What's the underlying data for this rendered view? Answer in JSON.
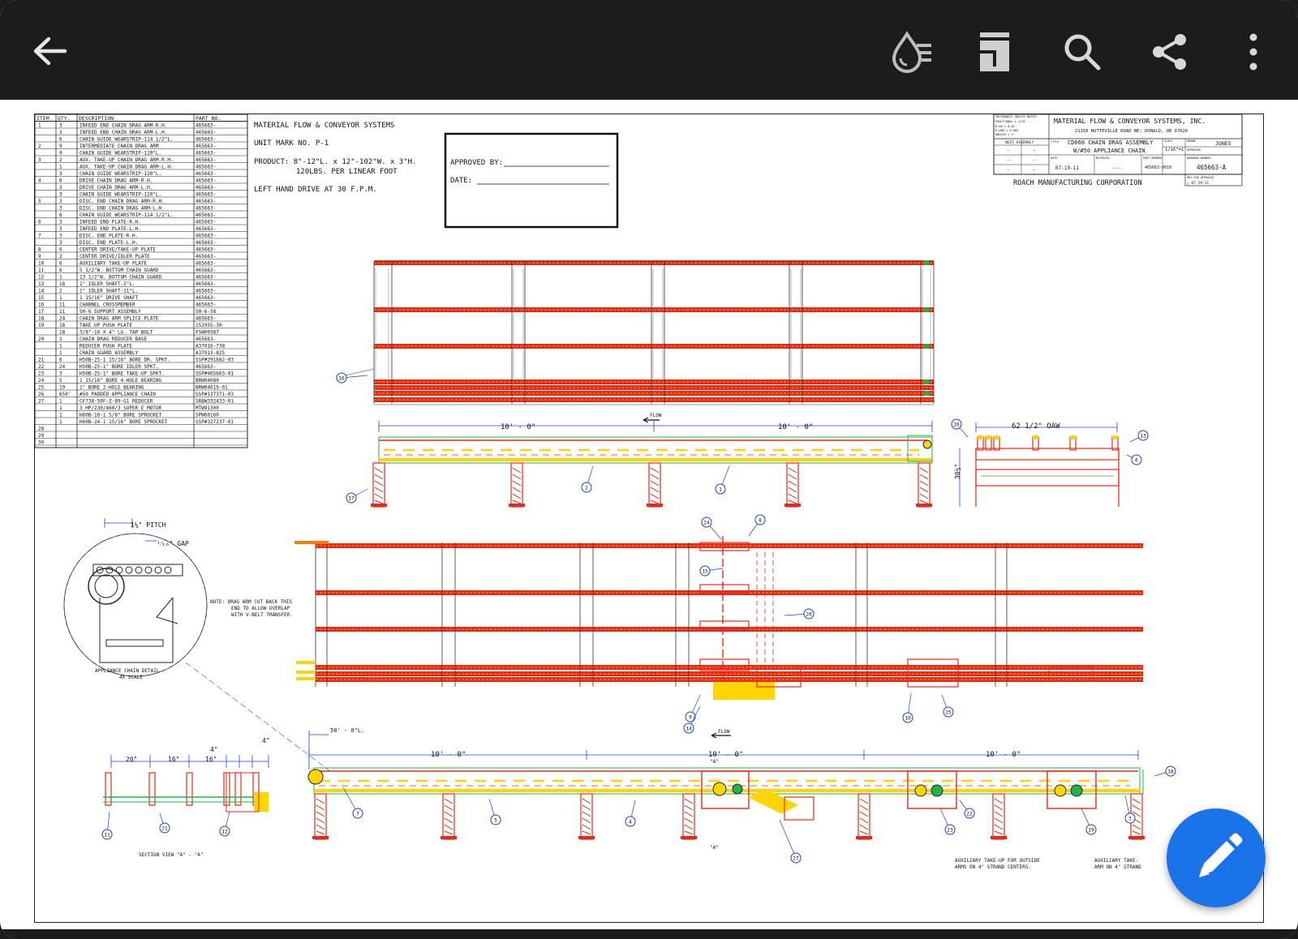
{
  "colors": {
    "appbar": "#1c1c1c",
    "fab": "#1a73e8",
    "conveyor_red": "#e8281a",
    "conveyor_orange": "#ff7a00",
    "yellow": "#ffd500",
    "green": "#22b14c",
    "blue": "#1a3fe0"
  },
  "icons": {
    "back": "arrow-left-icon",
    "ink": "ink-drop-icon",
    "reading_mode": "reading-mode-icon",
    "search": "search-icon",
    "share": "share-icon",
    "more": "more-vert-icon",
    "edit": "pencil-icon"
  },
  "bom": {
    "headers": {
      "item": "ITEM",
      "qty": "QTY.",
      "desc": "DESCRIPTION",
      "part": "PART NO."
    },
    "rows": [
      {
        "item": "1",
        "qty": "3",
        "desc": "INFEED END CHAIN DRAG ARM-R.H.",
        "part": "465663-"
      },
      {
        "item": "",
        "qty": "3",
        "desc": "INFEED END CHAIN DRAG ARM-L.H.",
        "part": "465663-"
      },
      {
        "item": "",
        "qty": "6",
        "desc": "CHAIN GUIDE WEARSTRIP-114 1/2\"L.",
        "part": "465663-"
      },
      {
        "item": "2",
        "qty": "9",
        "desc": "INTERMEDIATE CHAIN DRAG ARM",
        "part": "465663-"
      },
      {
        "item": "",
        "qty": "9",
        "desc": "CHAIN GUIDE WEARSTRIP-120\"L.",
        "part": "465663-"
      },
      {
        "item": "3",
        "qty": "2",
        "desc": "AUX. TAKE-UP CHAIN DRAG ARM-R.H.",
        "part": "465663-"
      },
      {
        "item": "",
        "qty": "1",
        "desc": "AUX. TAKE-UP CHAIN DRAG ARM-L.H.",
        "part": "465663-"
      },
      {
        "item": "",
        "qty": "3",
        "desc": "CHAIN GUIDE WEARSTRIP-120\"L.",
        "part": "465663-"
      },
      {
        "item": "4",
        "qty": "6",
        "desc": "DRIVE CHAIN DRAG ARM-R.H.",
        "part": "465663-"
      },
      {
        "item": "",
        "qty": "3",
        "desc": "DRIVE CHAIN DRAG ARM-L.H.",
        "part": "465663-"
      },
      {
        "item": "",
        "qty": "3",
        "desc": "CHAIN GUIDE WEARSTRIP-120\"L.",
        "part": "465663-"
      },
      {
        "item": "5",
        "qty": "3",
        "desc": "DISC. END CHAIN DRAG ARM-R.H.",
        "part": "465663-"
      },
      {
        "item": "",
        "qty": "3",
        "desc": "DISC. END CHAIN DRAG ARM-L.H.",
        "part": "465663-"
      },
      {
        "item": "",
        "qty": "6",
        "desc": "CHAIN GUIDE WEARSTRIP-114 1/2\"L.",
        "part": "465663-"
      },
      {
        "item": "6",
        "qty": "3",
        "desc": "INFEED END PLATE-R.H.",
        "part": "465663-"
      },
      {
        "item": "",
        "qty": "3",
        "desc": "INFEED END PLATE-L.H.",
        "part": "465663-"
      },
      {
        "item": "7",
        "qty": "3",
        "desc": "DISC. END PLATE-R.H.",
        "part": "465663-"
      },
      {
        "item": "",
        "qty": "3",
        "desc": "DISC. END PLATE-L.H.",
        "part": "465663-"
      },
      {
        "item": "8",
        "qty": "6",
        "desc": "CENTER DRIVE/TAKE-UP PLATE",
        "part": "465663-"
      },
      {
        "item": "9",
        "qty": "2",
        "desc": "CENTER DRIVE/IDLER PLATE",
        "part": "465663-"
      },
      {
        "item": "10",
        "qty": "6",
        "desc": "AUXILIARY TAKE-UP PLATE",
        "part": "465663-"
      },
      {
        "item": "11",
        "qty": "6",
        "desc": "5 1/2\"W. BOTTOM CHAIN GUARD",
        "part": "465663-"
      },
      {
        "item": "12",
        "qty": "1",
        "desc": "13 1/2\"W. BOTTOM CHAIN GUARD",
        "part": "465663-"
      },
      {
        "item": "13",
        "qty": "18",
        "desc": "1\" IDLER SHAFT-3\"L.",
        "part": "465663-"
      },
      {
        "item": "14",
        "qty": "2",
        "desc": "1\" IDLER SHAFT-11\"L.",
        "part": "465663-"
      },
      {
        "item": "15",
        "qty": "1",
        "desc": "1 15/16\" DRIVE SHAFT",
        "part": "465663-"
      },
      {
        "item": "16",
        "qty": "11",
        "desc": "CHANNEL CROSSMEMBER",
        "part": "465663-"
      },
      {
        "item": "17",
        "qty": "11",
        "desc": "SH-6 SUPPORT ASSEMBLY",
        "part": "SH-6-58"
      },
      {
        "item": "18",
        "qty": "24",
        "desc": "CHAIN DRAG ARM SPLICE PLATE",
        "part": "465663-"
      },
      {
        "item": "19",
        "qty": "18",
        "desc": "TAKE UP PUSH PLATE",
        "part": "152955-30"
      },
      {
        "item": "",
        "qty": "18",
        "desc": "3/8\"-16 X 4\" LG. TAP BOLT",
        "part": "FSW00387"
      },
      {
        "item": "20",
        "qty": "1",
        "desc": "CHAIN DRAG REDUCER BASE",
        "part": "465663-"
      },
      {
        "item": "",
        "qty": "1",
        "desc": "REDUCER PUSH PLATE",
        "part": "A37016-738"
      },
      {
        "item": "",
        "qty": "1",
        "desc": "CHAIN GUARD ASSEMBLY",
        "part": "A37913-825"
      },
      {
        "item": "21",
        "qty": "6",
        "desc": "H50B-25-1 15/16\" BORE DR. SPKT.",
        "part": "SSP#291682-03"
      },
      {
        "item": "22",
        "qty": "24",
        "desc": "H50B-25-1\" BORE IDLER SPKT.",
        "part": "465663-"
      },
      {
        "item": "23",
        "qty": "3",
        "desc": "H50B-25-1\" BORE TAKE-UP SPKT.",
        "part": "SSP#465663-01"
      },
      {
        "item": "24",
        "qty": "5",
        "desc": "1 15/16\" BORE 4-HOLE BEARING",
        "part": "BRW04080"
      },
      {
        "item": "25",
        "qty": "19",
        "desc": "1\" BORE 2-HOLE BEARING",
        "part": "BRW04010-01"
      },
      {
        "item": "26",
        "qty": "650'",
        "desc": "#50 PADDED APPLIANCE CHAIN",
        "part": "SSP#137371-03"
      },
      {
        "item": "27",
        "qty": "1",
        "desc": "CF738-50F-Z-89-G1 REDUCER",
        "part": "SRBW332433-01"
      },
      {
        "item": "",
        "qty": "1",
        "desc": "3 HP/230/460/3 SUPER E MOTOR",
        "part": "MTW91300"
      },
      {
        "item": "",
        "qty": "1",
        "desc": "H60B-16-1 5/8\" BORE SPROCKET",
        "part": "SPW60160"
      },
      {
        "item": "",
        "qty": "1",
        "desc": "H60B-24-1 15/16\" BORE SPROCKET",
        "part": "SSP#327237-01"
      },
      {
        "item": "28",
        "qty": "",
        "desc": "",
        "part": ""
      },
      {
        "item": "29",
        "qty": "",
        "desc": "",
        "part": ""
      },
      {
        "item": "30",
        "qty": "",
        "desc": "",
        "part": ""
      }
    ]
  },
  "header_notes": {
    "company": "MATERIAL FLOW & CONVEYOR SYSTEMS",
    "unit_mark": "UNIT MARK NO. P-1",
    "product_line1": "PRODUCT: 8\"-12\"L. x 12\"-102\"W. x 3\"H.",
    "product_line2": "120LBS. PER LINEAR FOOT",
    "drive": "LEFT HAND DRIVE AT 30 F.P.M."
  },
  "approval": {
    "approved_by": "APPROVED BY:",
    "date": "DATE:"
  },
  "title_block": {
    "tolerances": [
      "TOLERANCES UNLESS NOTED:",
      "FRACTIONAL ± 1/32",
      "0.00    ± 0.02",
      "0.000   ± 0.005",
      "ANGLES  ± 1°"
    ],
    "company_name": "MATERIAL FLOW & CONVEYOR SYSTEMS, INC.",
    "address": "21150 BUTTEVILLE ROAD NE; DONALD, OR  97020",
    "next_assembly": "NEXT ASSEMBLY",
    "title_label": "TITLE",
    "title_line1": "CD660 CHAIN DRAG ASSEMBLY",
    "title_line2": "W/#50 APPLIANCE CHAIN",
    "scale_label": "SCALE",
    "scale": "1/16\"=1'",
    "drawn_label": "DRAWN",
    "drawn": "JONES",
    "approved_label": "APPROVED",
    "date_label": "DATE",
    "date": "07-19-11",
    "material_label": "MATERIAL",
    "material": "---",
    "part_number_label": "PART NUMBER",
    "part_number": "465663-0010",
    "drawing_number_label": "DRAWING NUMBER",
    "drawing_number": "465663-A",
    "rev_label": "REV FOR APPROVAL",
    "rev": "△ 07-19-11",
    "dash": "-",
    "manufacturer": "ROACH MANUFACTURING CORPORATION"
  },
  "dims": {
    "ten_ft": "10' - 0\"",
    "flow": "FLOW",
    "oaw": "62 1/2\" OAW",
    "height": "30½\"",
    "fifty_ft": "50' - 0\"L.",
    "pitch": "1¼\" PITCH",
    "gap": "¹⁄₁₆\" GAP",
    "twenty": "20\"",
    "sixteen": "16\"",
    "four": "4\"",
    "section_a": "\"A\""
  },
  "notes": {
    "drag_arm_line1": "NOTE: DRAG ARM CUT BACK THIS",
    "drag_arm_line2": "END TO ALLOW OVERLAP",
    "drag_arm_line3": "WITH V-BELT TRANSFER.",
    "detail_line1": "APPLIANCE CHAIN DETAIL",
    "detail_line2": "4X SCALE",
    "section": "SECTION VIEW \"A\" - \"A\"",
    "aux_line1": "AUXILIARY TAKE-UP FOR OUTSIDE",
    "aux_line2": "ARMS ON 4\" STRAND CENTERS.",
    "aux2_line1": "AUXILIARY TAKE-",
    "aux2_line2": "ARM ON 4\" STRAND"
  },
  "balloons": {
    "b1": "1",
    "b2": "2",
    "b3": "3",
    "b4": "4",
    "b5": "5",
    "b6": "6",
    "b7": "7",
    "b8": "8",
    "b9": "9",
    "b10": "10",
    "b11": "11",
    "b12": "12",
    "b13": "13",
    "b14": "14",
    "b15": "15",
    "b16": "16",
    "b17": "17",
    "b18": "18",
    "b19": "19",
    "b20": "20",
    "b21": "21",
    "b22": "22",
    "b23": "23",
    "b24": "24",
    "b25": "25",
    "b26": "26",
    "b27": "27"
  }
}
